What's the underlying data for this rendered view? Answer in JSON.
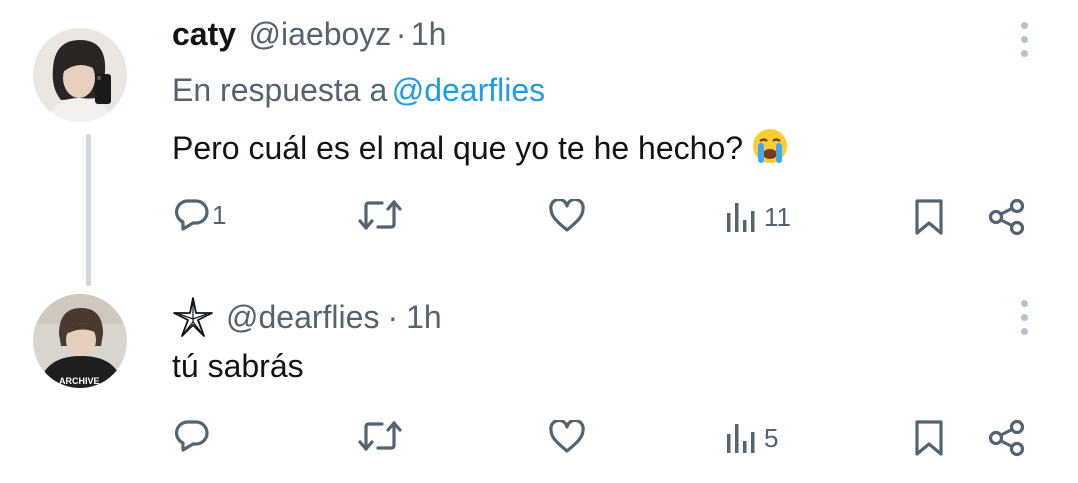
{
  "tweets": [
    {
      "display_name": "caty",
      "handle": "@iaeboyz",
      "separator": "·",
      "time": "1h",
      "reply_prefix": "En respuesta a",
      "reply_to": "@dearflies",
      "text": "Pero cuál es el mal que yo te he hecho?",
      "emoji": "😭",
      "replies": "1",
      "retweets": "",
      "likes": "",
      "views": "11"
    },
    {
      "display_name_icon": "starfish-icon",
      "handle": "@dearflies",
      "separator": "·",
      "time": "1h",
      "text": "tú sabrás",
      "replies": "",
      "retweets": "",
      "likes": "",
      "views": "5",
      "avatar_text": "ARCHIVE"
    }
  ],
  "colors": {
    "accent": "#1d9bf0",
    "muted": "#536471",
    "thread_line": "#cfd9de"
  }
}
